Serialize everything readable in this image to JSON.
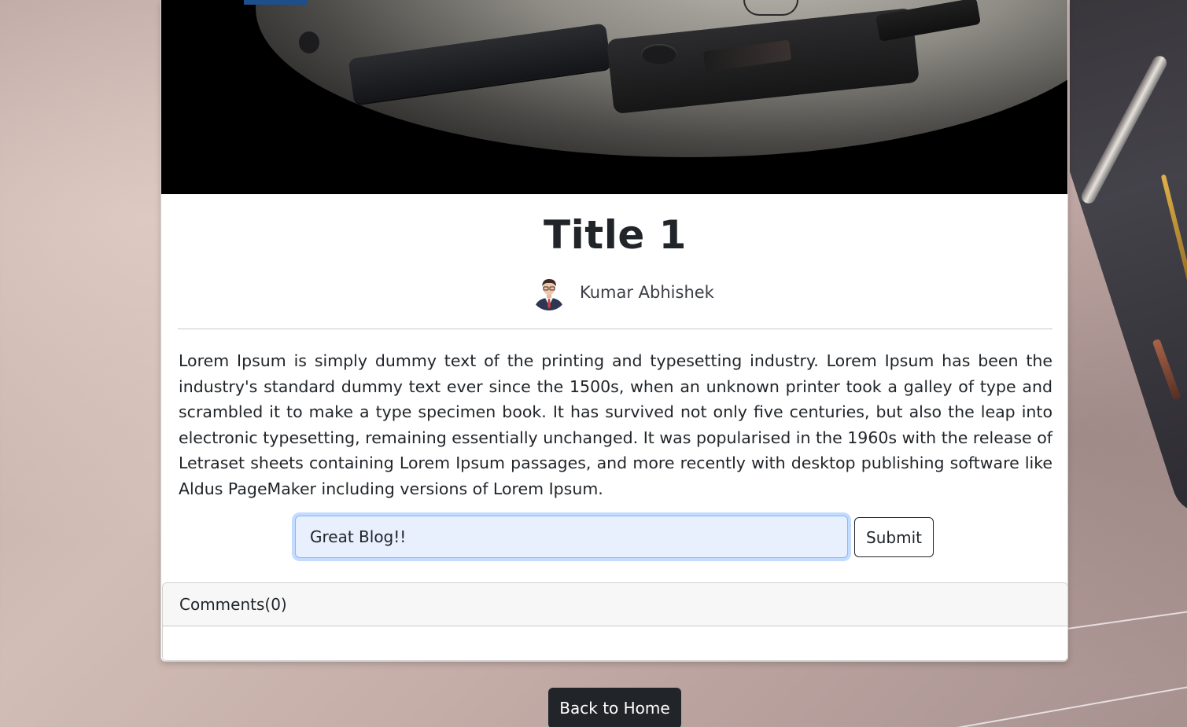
{
  "post": {
    "title": "Title 1",
    "author": "Kumar Abhishek",
    "content": "Lorem Ipsum is simply dummy text of the printing and typesetting industry. Lorem Ipsum has been the industry's standard dummy text ever since the 1500s, when an unknown printer took a galley of type and scrambled it to make a type specimen book. It has survived not only five centuries, but also the leap into electronic typesetting, remaining essentially unchanged. It was popularised in the 1960s with the release of Letraset sheets containing Lorem Ipsum passages, and more recently with desktop publishing software like Aldus PageMaker including versions of Lorem Ipsum."
  },
  "comment_form": {
    "value": "Great Blog!!",
    "submit_label": "Submit"
  },
  "comments": {
    "header": "Comments(0)",
    "items": []
  },
  "nav": {
    "back_label": "Back to Home"
  },
  "colors": {
    "primary_dark": "#212529",
    "focus_ring": "#86b7fe",
    "input_bg": "#e8f0fe"
  },
  "icons": {
    "avatar": "author-avatar-icon"
  }
}
